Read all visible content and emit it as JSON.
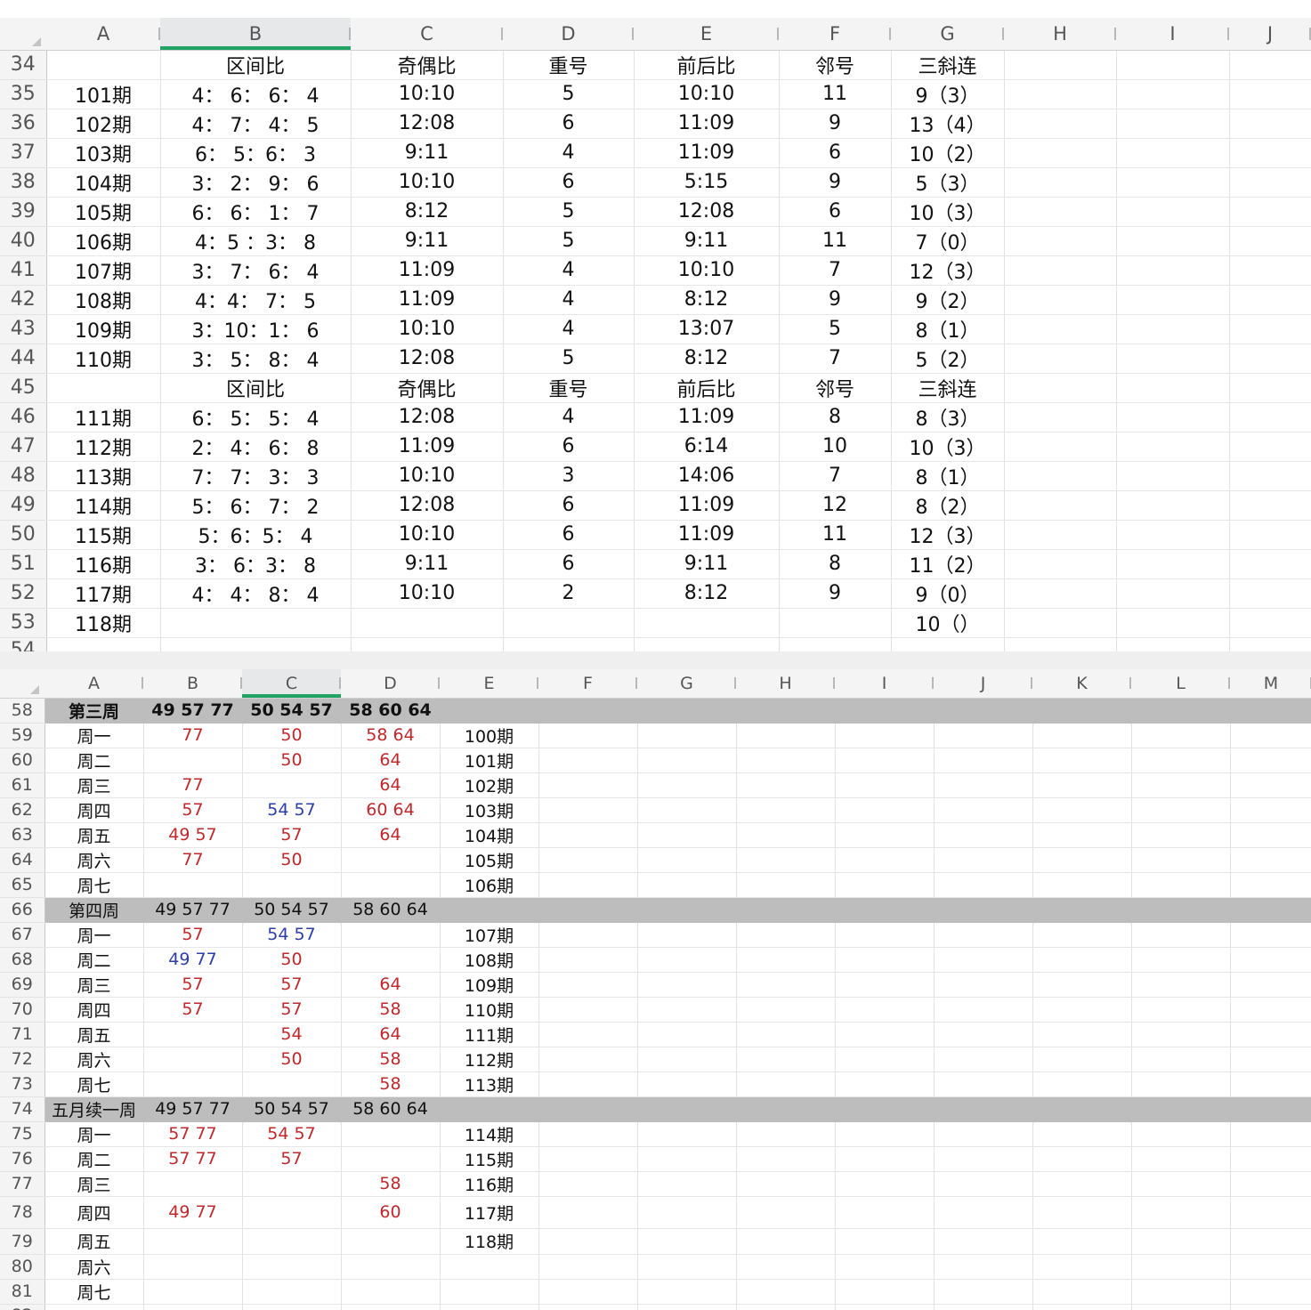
{
  "top": {
    "column_headers": [
      "A",
      "B",
      "C",
      "D",
      "E",
      "F",
      "G",
      "H",
      "I",
      "J"
    ],
    "selected_column": "B",
    "rows": [
      {
        "num": "34",
        "cells": [
          "",
          "区间比",
          "奇偶比",
          "重号",
          "前后比",
          "邻号",
          "三斜连",
          "",
          "",
          ""
        ]
      },
      {
        "num": "35",
        "cells": [
          "101期",
          "4： 6： 6： 4",
          "10:10",
          "5",
          "10:10",
          "11",
          "9（3）",
          "",
          "",
          ""
        ]
      },
      {
        "num": "36",
        "cells": [
          "102期",
          "4： 7： 4： 5",
          "12:08",
          "6",
          "11:09",
          "9",
          "13（4）",
          "",
          "",
          ""
        ]
      },
      {
        "num": "37",
        "cells": [
          "103期",
          "6： 5：6： 3",
          "9:11",
          "4",
          "11:09",
          "6",
          "10（2）",
          "",
          "",
          ""
        ]
      },
      {
        "num": "38",
        "cells": [
          "104期",
          "3： 2： 9： 6",
          "10:10",
          "6",
          "5:15",
          "9",
          "5（3）",
          "",
          "",
          ""
        ]
      },
      {
        "num": "39",
        "cells": [
          "105期",
          "6： 6： 1： 7",
          "8:12",
          "5",
          "12:08",
          "6",
          "10（3）",
          "",
          "",
          ""
        ]
      },
      {
        "num": "40",
        "cells": [
          "106期",
          "4：5 ：3： 8",
          "9:11",
          "5",
          "9:11",
          "11",
          "7（0）",
          "",
          "",
          ""
        ]
      },
      {
        "num": "41",
        "cells": [
          "107期",
          "3： 7： 6： 4",
          "11:09",
          "4",
          "10:10",
          "7",
          "12（3）",
          "",
          "",
          ""
        ]
      },
      {
        "num": "42",
        "cells": [
          "108期",
          "4：4： 7： 5",
          "11:09",
          "4",
          "8:12",
          "9",
          "9（2）",
          "",
          "",
          ""
        ]
      },
      {
        "num": "43",
        "cells": [
          "109期",
          "3：10：1： 6",
          "10:10",
          "4",
          "13:07",
          "5",
          "8（1）",
          "",
          "",
          ""
        ]
      },
      {
        "num": "44",
        "cells": [
          "110期",
          "3： 5： 8： 4",
          "12:08",
          "5",
          "8:12",
          "7",
          "5（2）",
          "",
          "",
          ""
        ]
      },
      {
        "num": "45",
        "cells": [
          "",
          "区间比",
          "奇偶比",
          "重号",
          "前后比",
          "邻号",
          "三斜连",
          "",
          "",
          ""
        ]
      },
      {
        "num": "46",
        "cells": [
          "111期",
          "6： 5： 5： 4",
          "12:08",
          "4",
          "11:09",
          "8",
          "8（3）",
          "",
          "",
          ""
        ]
      },
      {
        "num": "47",
        "cells": [
          "112期",
          "2： 4： 6： 8",
          "11:09",
          "6",
          "6:14",
          "10",
          "10（3）",
          "",
          "",
          ""
        ]
      },
      {
        "num": "48",
        "cells": [
          "113期",
          "7： 7： 3： 3",
          "10:10",
          "3",
          "14:06",
          "7",
          "8（1）",
          "",
          "",
          ""
        ]
      },
      {
        "num": "49",
        "cells": [
          "114期",
          "5： 6： 7： 2",
          "12:08",
          "6",
          "11:09",
          "12",
          "8（2）",
          "",
          "",
          ""
        ]
      },
      {
        "num": "50",
        "cells": [
          "115期",
          "5：6：5： 4",
          "10:10",
          "6",
          "11:09",
          "11",
          "12（3）",
          "",
          "",
          ""
        ]
      },
      {
        "num": "51",
        "cells": [
          "116期",
          "3： 6：3： 8",
          "9:11",
          "6",
          "9:11",
          "8",
          "11（2）",
          "",
          "",
          ""
        ]
      },
      {
        "num": "52",
        "cells": [
          "117期",
          "4： 4： 8： 4",
          "10:10",
          "2",
          "8:12",
          "9",
          "9（0）",
          "",
          "",
          ""
        ]
      },
      {
        "num": "53",
        "cells": [
          "118期",
          "",
          "",
          "",
          "",
          "",
          "10（）",
          "",
          "",
          ""
        ]
      },
      {
        "num": "54",
        "cells": [
          "",
          "",
          "",
          "",
          "",
          "",
          "",
          "",
          "",
          ""
        ]
      },
      {
        "num": "55",
        "cells": [
          "",
          "",
          "",
          "",
          "",
          "",
          "",
          "",
          "",
          ""
        ]
      }
    ]
  },
  "bottom": {
    "column_headers": [
      "A",
      "B",
      "C",
      "D",
      "E",
      "F",
      "G",
      "H",
      "I",
      "J",
      "K",
      "L",
      "M"
    ],
    "selected_column": "C",
    "rows": [
      {
        "num": "58",
        "week": true,
        "bold": true,
        "cells": [
          {
            "t": "第三周"
          },
          {
            "t": "49 57 77"
          },
          {
            "t": "50 54 57"
          },
          {
            "t": "58 60 64"
          },
          {
            "t": ""
          }
        ]
      },
      {
        "num": "59",
        "cells": [
          {
            "t": "周一"
          },
          {
            "t": "77",
            "c": "red"
          },
          {
            "t": "50",
            "c": "red"
          },
          {
            "t": "58 64",
            "c": "red"
          },
          {
            "t": "100期"
          }
        ]
      },
      {
        "num": "60",
        "cells": [
          {
            "t": "周二"
          },
          {
            "t": ""
          },
          {
            "t": "50",
            "c": "red"
          },
          {
            "t": "64",
            "c": "red"
          },
          {
            "t": "101期"
          }
        ]
      },
      {
        "num": "61",
        "cells": [
          {
            "t": "周三"
          },
          {
            "t": "77",
            "c": "red"
          },
          {
            "t": ""
          },
          {
            "t": "64",
            "c": "red"
          },
          {
            "t": "102期"
          }
        ]
      },
      {
        "num": "62",
        "cells": [
          {
            "t": "周四"
          },
          {
            "t": "57",
            "c": "red"
          },
          {
            "t": "54 57",
            "c": "blue"
          },
          {
            "t": "60 64",
            "c": "red"
          },
          {
            "t": "103期"
          }
        ]
      },
      {
        "num": "63",
        "cells": [
          {
            "t": "周五"
          },
          {
            "t": "49 57",
            "c": "red"
          },
          {
            "t": "57",
            "c": "red"
          },
          {
            "t": "64",
            "c": "red"
          },
          {
            "t": "104期"
          }
        ]
      },
      {
        "num": "64",
        "cells": [
          {
            "t": "周六"
          },
          {
            "t": "77",
            "c": "red"
          },
          {
            "t": "50",
            "c": "red"
          },
          {
            "t": ""
          },
          {
            "t": "105期"
          }
        ]
      },
      {
        "num": "65",
        "cells": [
          {
            "t": "周七"
          },
          {
            "t": ""
          },
          {
            "t": ""
          },
          {
            "t": ""
          },
          {
            "t": "106期"
          }
        ]
      },
      {
        "num": "66",
        "week": true,
        "cells": [
          {
            "t": "第四周"
          },
          {
            "t": "49 57 77"
          },
          {
            "t": "50 54 57"
          },
          {
            "t": "58 60 64"
          },
          {
            "t": ""
          }
        ]
      },
      {
        "num": "67",
        "cells": [
          {
            "t": "周一"
          },
          {
            "t": "57",
            "c": "red"
          },
          {
            "t": "54 57",
            "c": "blue"
          },
          {
            "t": ""
          },
          {
            "t": "107期"
          }
        ]
      },
      {
        "num": "68",
        "cells": [
          {
            "t": "周二"
          },
          {
            "t": "49 77",
            "c": "blue"
          },
          {
            "t": "50",
            "c": "red"
          },
          {
            "t": ""
          },
          {
            "t": "108期"
          }
        ]
      },
      {
        "num": "69",
        "cells": [
          {
            "t": "周三"
          },
          {
            "t": "57",
            "c": "red"
          },
          {
            "t": "57",
            "c": "red"
          },
          {
            "t": "64",
            "c": "red"
          },
          {
            "t": "109期"
          }
        ]
      },
      {
        "num": "70",
        "cells": [
          {
            "t": "周四"
          },
          {
            "t": "57",
            "c": "red"
          },
          {
            "t": "57",
            "c": "red"
          },
          {
            "t": "58",
            "c": "red"
          },
          {
            "t": "110期"
          }
        ]
      },
      {
        "num": "71",
        "cells": [
          {
            "t": "周五"
          },
          {
            "t": ""
          },
          {
            "t": "54",
            "c": "red"
          },
          {
            "t": "64",
            "c": "red"
          },
          {
            "t": "111期"
          }
        ]
      },
      {
        "num": "72",
        "cells": [
          {
            "t": "周六"
          },
          {
            "t": ""
          },
          {
            "t": "50",
            "c": "red"
          },
          {
            "t": "58",
            "c": "red"
          },
          {
            "t": "112期"
          }
        ]
      },
      {
        "num": "73",
        "cells": [
          {
            "t": "周七"
          },
          {
            "t": ""
          },
          {
            "t": ""
          },
          {
            "t": "58",
            "c": "red"
          },
          {
            "t": "113期"
          }
        ]
      },
      {
        "num": "74",
        "week": true,
        "cells": [
          {
            "t": "五月续一周"
          },
          {
            "t": "49 57 77"
          },
          {
            "t": "50 54 57"
          },
          {
            "t": "58 60 64"
          },
          {
            "t": ""
          }
        ]
      },
      {
        "num": "75",
        "cells": [
          {
            "t": "周一"
          },
          {
            "t": "57 77",
            "c": "red"
          },
          {
            "t": "54 57",
            "c": "red"
          },
          {
            "t": ""
          },
          {
            "t": "114期"
          }
        ]
      },
      {
        "num": "76",
        "cells": [
          {
            "t": "周二"
          },
          {
            "t": "57 77",
            "c": "red"
          },
          {
            "t": "57",
            "c": "red"
          },
          {
            "t": ""
          },
          {
            "t": "115期"
          }
        ]
      },
      {
        "num": "77",
        "cells": [
          {
            "t": "周三"
          },
          {
            "t": ""
          },
          {
            "t": ""
          },
          {
            "t": "58",
            "c": "red"
          },
          {
            "t": "116期"
          }
        ]
      },
      {
        "num": "78",
        "cells": [
          {
            "t": "周四"
          },
          {
            "t": "49 77",
            "c": "red"
          },
          {
            "t": ""
          },
          {
            "t": "60",
            "c": "red"
          },
          {
            "t": "117期"
          }
        ]
      },
      {
        "num": "79",
        "cells": [
          {
            "t": "周五"
          },
          {
            "t": ""
          },
          {
            "t": ""
          },
          {
            "t": ""
          },
          {
            "t": "118期"
          }
        ]
      },
      {
        "num": "80",
        "cells": [
          {
            "t": "周六"
          },
          {
            "t": ""
          },
          {
            "t": ""
          },
          {
            "t": ""
          },
          {
            "t": ""
          }
        ]
      },
      {
        "num": "81",
        "cells": [
          {
            "t": "周七"
          },
          {
            "t": ""
          },
          {
            "t": ""
          },
          {
            "t": ""
          },
          {
            "t": ""
          }
        ]
      },
      {
        "num": "82",
        "cells": [
          {
            "t": ""
          },
          {
            "t": ""
          },
          {
            "t": ""
          },
          {
            "t": ""
          },
          {
            "t": ""
          }
        ]
      }
    ]
  },
  "colors": {
    "selection_accent": "#21a366",
    "red_text": "#c0282b",
    "blue_text": "#2b3fa6",
    "week_row_fill": "#bdbdbd"
  }
}
